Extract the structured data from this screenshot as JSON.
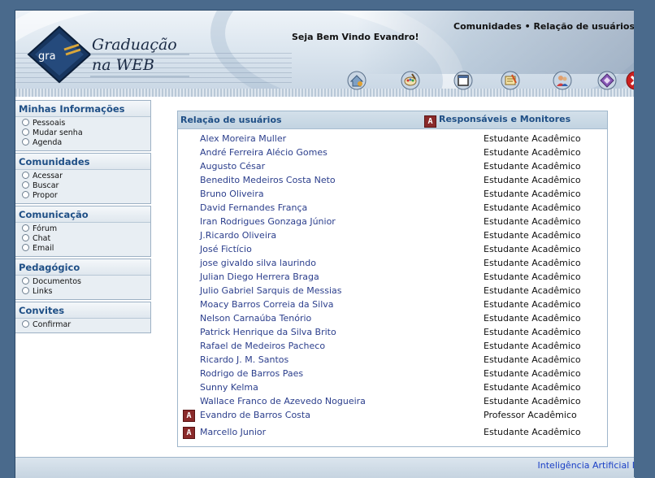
{
  "header": {
    "logo_text_line1": "Graduação",
    "logo_text_line2": "na WEB",
    "logo_mark": "gra",
    "welcome": "Seja Bem Vindo Evandro!",
    "breadcrumb": "Comunidades • Relação de usuários",
    "toolbar_icons": [
      "home-icon",
      "palette-icon",
      "window-icon",
      "notes-icon",
      "users-icon",
      "book-icon",
      "close-icon"
    ]
  },
  "sidebar": {
    "sections": [
      {
        "title": "Minhas Informações",
        "items": [
          "Pessoais",
          "Mudar senha",
          "Agenda"
        ]
      },
      {
        "title": "Comunidades",
        "items": [
          "Acessar",
          "Buscar",
          "Propor"
        ]
      },
      {
        "title": "Comunicação",
        "items": [
          "Fórum",
          "Chat",
          "Email"
        ]
      },
      {
        "title": "Pedagógico",
        "items": [
          "Documentos",
          "Links"
        ]
      },
      {
        "title": "Convites",
        "items": [
          "Confirmar"
        ]
      }
    ]
  },
  "panel": {
    "title": "Relação de usuários",
    "legend_icon": "A",
    "legend": "Responsáveis e Monitores",
    "users": [
      {
        "name": "Alex Moreira Muller",
        "role": "Estudante Acadêmico",
        "responsible": false
      },
      {
        "name": "André Ferreira Alécio Gomes",
        "role": "Estudante Acadêmico",
        "responsible": false
      },
      {
        "name": "Augusto César",
        "role": "Estudante Acadêmico",
        "responsible": false
      },
      {
        "name": "Benedito Medeiros Costa Neto",
        "role": "Estudante Acadêmico",
        "responsible": false
      },
      {
        "name": "Bruno Oliveira",
        "role": "Estudante Acadêmico",
        "responsible": false
      },
      {
        "name": "David Fernandes França",
        "role": "Estudante Acadêmico",
        "responsible": false
      },
      {
        "name": "Iran Rodrigues Gonzaga Júnior",
        "role": "Estudante Acadêmico",
        "responsible": false
      },
      {
        "name": "J.Ricardo Oliveira",
        "role": "Estudante Acadêmico",
        "responsible": false
      },
      {
        "name": "José Fictício",
        "role": "Estudante Acadêmico",
        "responsible": false
      },
      {
        "name": "jose givaldo silva laurindo",
        "role": "Estudante Acadêmico",
        "responsible": false
      },
      {
        "name": "Julian Diego Herrera Braga",
        "role": "Estudante Acadêmico",
        "responsible": false
      },
      {
        "name": "Julio Gabriel Sarquis de Messias",
        "role": "Estudante Acadêmico",
        "responsible": false
      },
      {
        "name": "Moacy Barros Correia da Silva",
        "role": "Estudante Acadêmico",
        "responsible": false
      },
      {
        "name": "Nelson Carnaúba Tenório",
        "role": "Estudante Acadêmico",
        "responsible": false
      },
      {
        "name": "Patrick Henrique da Silva Brito",
        "role": "Estudante Acadêmico",
        "responsible": false
      },
      {
        "name": "Rafael de Medeiros Pacheco",
        "role": "Estudante Acadêmico",
        "responsible": false
      },
      {
        "name": "Ricardo J. M. Santos",
        "role": "Estudante Acadêmico",
        "responsible": false
      },
      {
        "name": "Rodrigo de Barros Paes",
        "role": "Estudante Acadêmico",
        "responsible": false
      },
      {
        "name": "Sunny Kelma",
        "role": "Estudante Acadêmico",
        "responsible": false
      },
      {
        "name": "Wallace Franco de Azevedo Nogueira",
        "role": "Estudante Acadêmico",
        "responsible": false
      },
      {
        "name": "Evandro de Barros Costa",
        "role": "Professor Acadêmico",
        "responsible": true
      },
      {
        "name": "Marcello Junior",
        "role": "Estudante Acadêmico",
        "responsible": true
      }
    ]
  },
  "footer": {
    "text": "Inteligência Artificial I"
  },
  "colors": {
    "page_bg": "#4a6a8c",
    "link": "#2b3e8c",
    "section_title": "#1f4f86",
    "responsible_icon": "#8a2a2a",
    "close_red": "#cc1f1f"
  }
}
